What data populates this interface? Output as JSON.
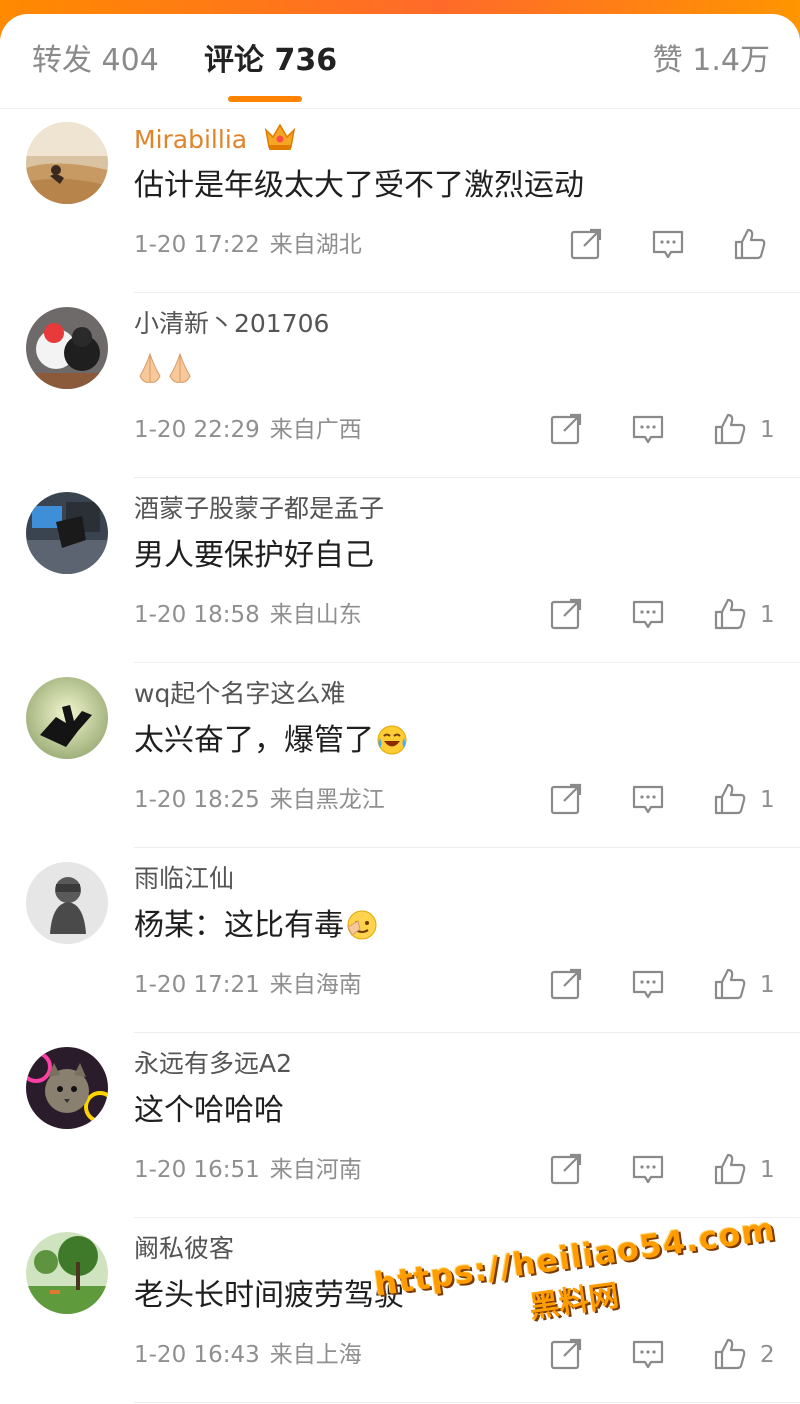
{
  "tabs": {
    "repost": "转发 404",
    "comments": "评论 736",
    "likes": "赞 1.4万"
  },
  "comments": [
    {
      "user": "Mirabillia",
      "text": "估计是年级太大了受不了激烈运动",
      "time": "1-20 17:22",
      "location": "来自湖北",
      "likes": ""
    },
    {
      "user": "小清新丶201706",
      "text": "",
      "time": "1-20 22:29",
      "location": "来自广西",
      "likes": "1"
    },
    {
      "user": "酒蒙子股蒙子都是孟子",
      "text": "男人要保护好自己",
      "time": "1-20 18:58",
      "location": "来自山东",
      "likes": "1"
    },
    {
      "user": "wq起个名字这么难",
      "text": "太兴奋了，爆管了",
      "time": "1-20 18:25",
      "location": "来自黑龙江",
      "likes": "1"
    },
    {
      "user": "雨临江仙",
      "text": "杨某：这比有毒",
      "time": "1-20 17:21",
      "location": "来自海南",
      "likes": "1"
    },
    {
      "user": "永远有多远A2",
      "text": "这个哈哈哈",
      "time": "1-20 16:51",
      "location": "来自河南",
      "likes": "1"
    },
    {
      "user": "阚私彼客",
      "text": "老头长时间疲劳驾驶",
      "time": "1-20 16:43",
      "location": "来自上海",
      "likes": "2"
    }
  ],
  "watermark": {
    "url": "https://heiliao54.com",
    "name": "黑料网"
  },
  "colors": {
    "accent": "#ff8200",
    "vip_name": "#e0832a",
    "meta": "#8f8f8f"
  },
  "icons": {
    "repost": "share-icon",
    "comment": "comment-icon",
    "like": "thumbs-up-icon"
  }
}
